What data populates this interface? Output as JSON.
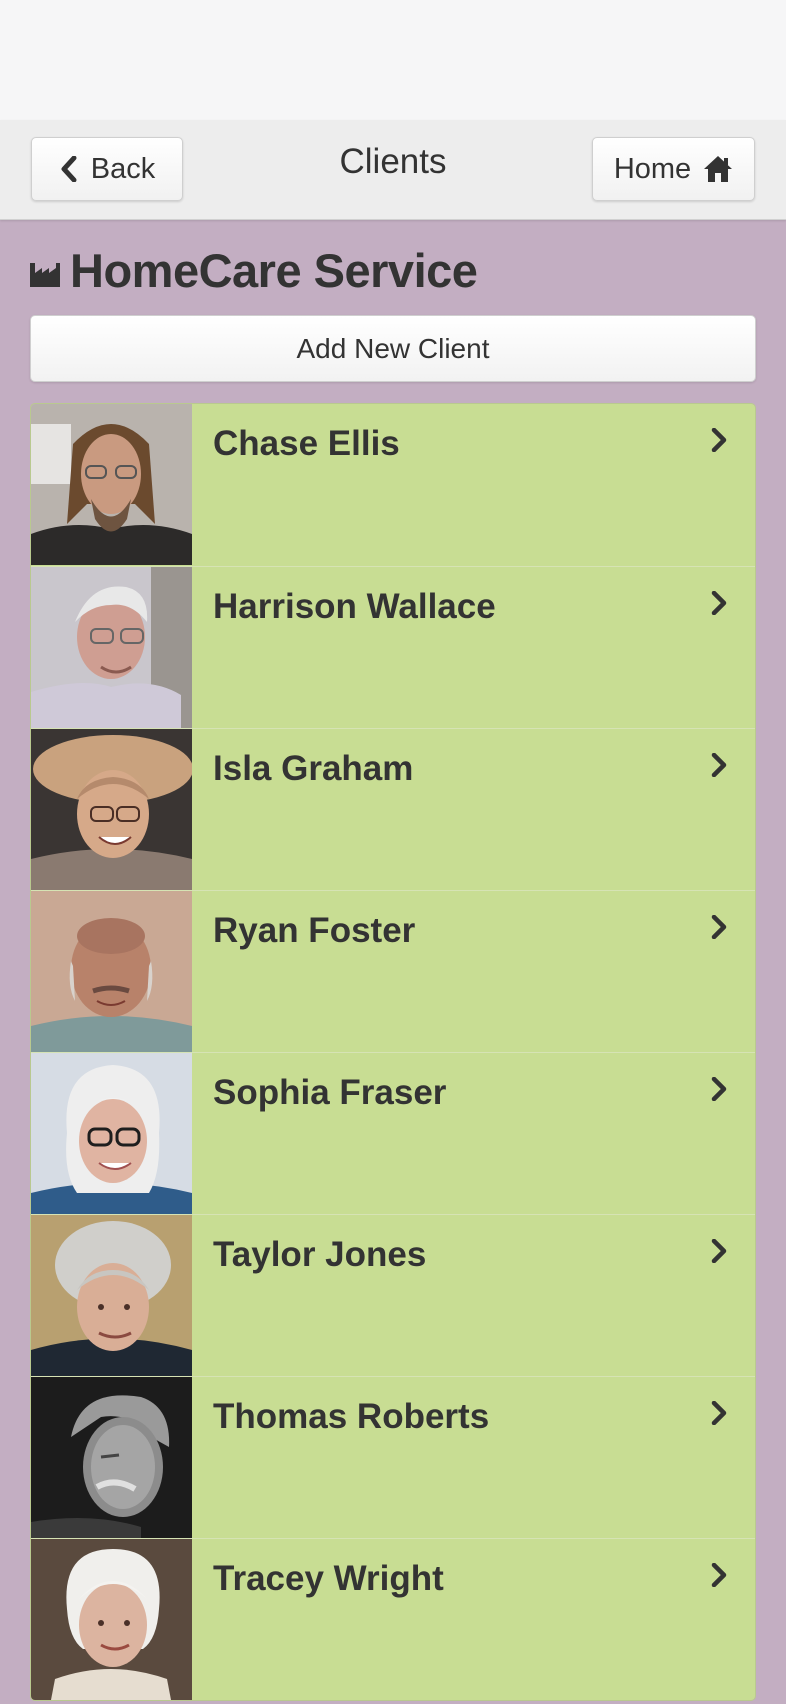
{
  "header": {
    "title": "Clients",
    "back_label": "Back",
    "home_label": "Home"
  },
  "brand": {
    "title": "HomeCare Service",
    "icon": "factory-icon"
  },
  "actions": {
    "add_client_label": "Add New Client"
  },
  "clients": [
    {
      "name": "Chase Ellis"
    },
    {
      "name": "Harrison Wallace"
    },
    {
      "name": "Isla Graham"
    },
    {
      "name": "Ryan Foster"
    },
    {
      "name": "Sophia Fraser"
    },
    {
      "name": "Taylor Jones"
    },
    {
      "name": "Thomas Roberts"
    },
    {
      "name": "Tracey Wright"
    }
  ],
  "colors": {
    "page_background": "#c3aec2",
    "list_item_background": "#c8dd93",
    "header_background": "#ededed",
    "text": "#333333"
  }
}
